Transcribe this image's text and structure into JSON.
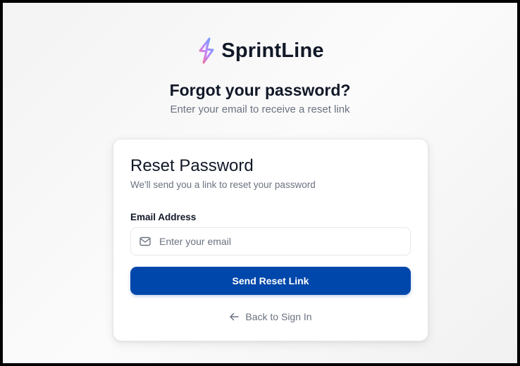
{
  "brand": {
    "logo_icon": "lightning-bolt-icon",
    "name": "SprintLine",
    "gradient": [
      "#f43f5e",
      "#a855f7",
      "#3b82f6"
    ]
  },
  "page": {
    "heading": "Forgot your password?",
    "subheading": "Enter your email to receive a reset link"
  },
  "card": {
    "title": "Reset Password",
    "description": "We'll send you a link to reset your password",
    "email_label": "Email Address",
    "email_icon": "mail-icon",
    "email_placeholder": "Enter your email",
    "email_value": "",
    "submit_label": "Send Reset Link",
    "back_icon": "arrow-left-icon",
    "back_label": "Back to Sign In"
  },
  "colors": {
    "primary": "#0047ab",
    "text_dark": "#111827",
    "text_muted": "#6b7280",
    "border": "#e5e7eb"
  }
}
